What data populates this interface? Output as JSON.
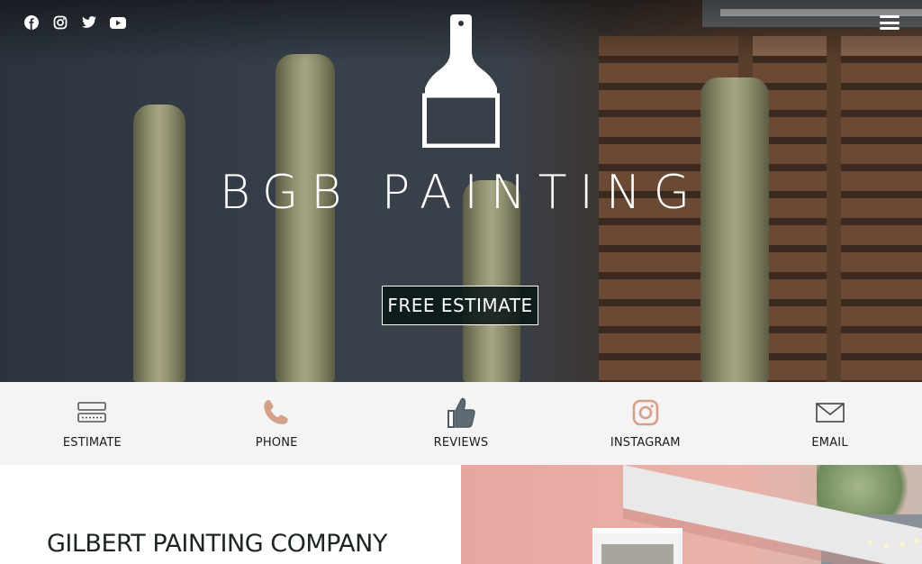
{
  "social": [
    {
      "name": "facebook-icon"
    },
    {
      "name": "instagram-icon"
    },
    {
      "name": "twitter-icon"
    },
    {
      "name": "youtube-icon"
    }
  ],
  "brand": {
    "name": "BGB PAINTING",
    "logo_icon": "paint-brush-icon"
  },
  "hero": {
    "cta_label": "FREE ESTIMATE"
  },
  "quick_links": [
    {
      "label": "ESTIMATE",
      "icon": "estimate-form-icon",
      "color": "#555555"
    },
    {
      "label": "PHONE",
      "icon": "phone-icon",
      "color": "#d4a08a"
    },
    {
      "label": "REVIEWS",
      "icon": "thumbs-up-icon",
      "color": "#4c5b63"
    },
    {
      "label": "INSTAGRAM",
      "icon": "instagram-icon",
      "color": "#d4a08a"
    },
    {
      "label": "EMAIL",
      "icon": "envelope-icon",
      "color": "#444444"
    }
  ],
  "section": {
    "heading": "GILBERT PAINTING COMPANY"
  },
  "colors": {
    "quickbar_bg": "#f4f4f4",
    "heading": "#1d2424",
    "accent_peach": "#d4a08a"
  }
}
